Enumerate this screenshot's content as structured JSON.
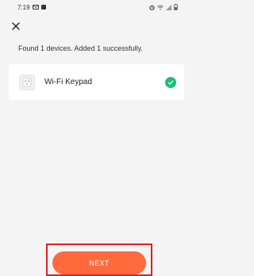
{
  "status_bar": {
    "time": "7:19",
    "left_icons": [
      "message-icon",
      "notification-icon"
    ],
    "right_icons": [
      "alarm-icon",
      "wifi-icon",
      "signal-icon",
      "battery-icon"
    ]
  },
  "header": {
    "close_icon": "close-icon"
  },
  "result": {
    "message": "Found 1 devices. Added 1 successfully."
  },
  "devices": [
    {
      "name": "Wi-Fi Keypad",
      "icon": "keypad-icon",
      "status_icon": "check-circle-icon",
      "status_color": "#1fbf75"
    }
  ],
  "footer": {
    "next_label": "NEXT",
    "accent": "#ff6a3d",
    "highlight": "#e02020"
  }
}
